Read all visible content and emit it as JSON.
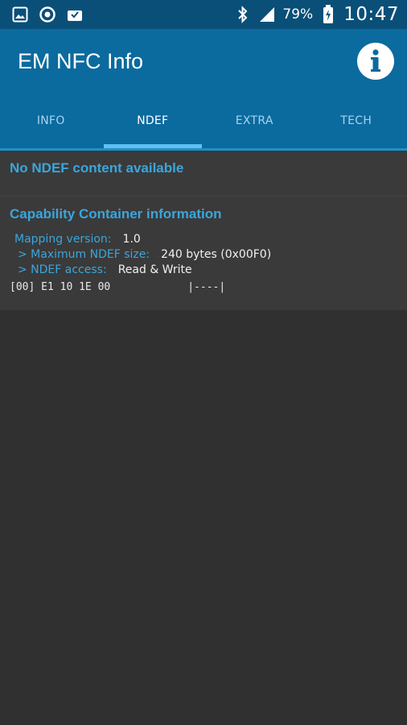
{
  "status_bar": {
    "left_icons": [
      "gallery-icon",
      "sync-icon",
      "download-icon"
    ],
    "battery": "79%",
    "time": "10:47"
  },
  "app_bar": {
    "title": "EM NFC Info",
    "info_icon": "info-icon"
  },
  "tabs": [
    {
      "label": "INFO",
      "active": false
    },
    {
      "label": "NDEF",
      "active": true
    },
    {
      "label": "EXTRA",
      "active": false
    },
    {
      "label": "TECH",
      "active": false
    }
  ],
  "ndef": {
    "no_content": "No NDEF content available"
  },
  "capability": {
    "title": "Capability Container information",
    "mapping_version_label": "Mapping version:",
    "mapping_version_value": "1.0",
    "max_size_label": "> Maximum NDEF size:",
    "max_size_value": "240 bytes (0x00F0)",
    "access_label": "> NDEF access:",
    "access_value": "Read & Write",
    "hex_offset": "[00] E1 10 1E 00",
    "hex_ascii": "|----|"
  },
  "colors": {
    "status_bar": "#0a4f78",
    "app_bar": "#0b6a9e",
    "accent": "#3aa6dc",
    "background": "#303030",
    "card": "#3a3a3a"
  }
}
